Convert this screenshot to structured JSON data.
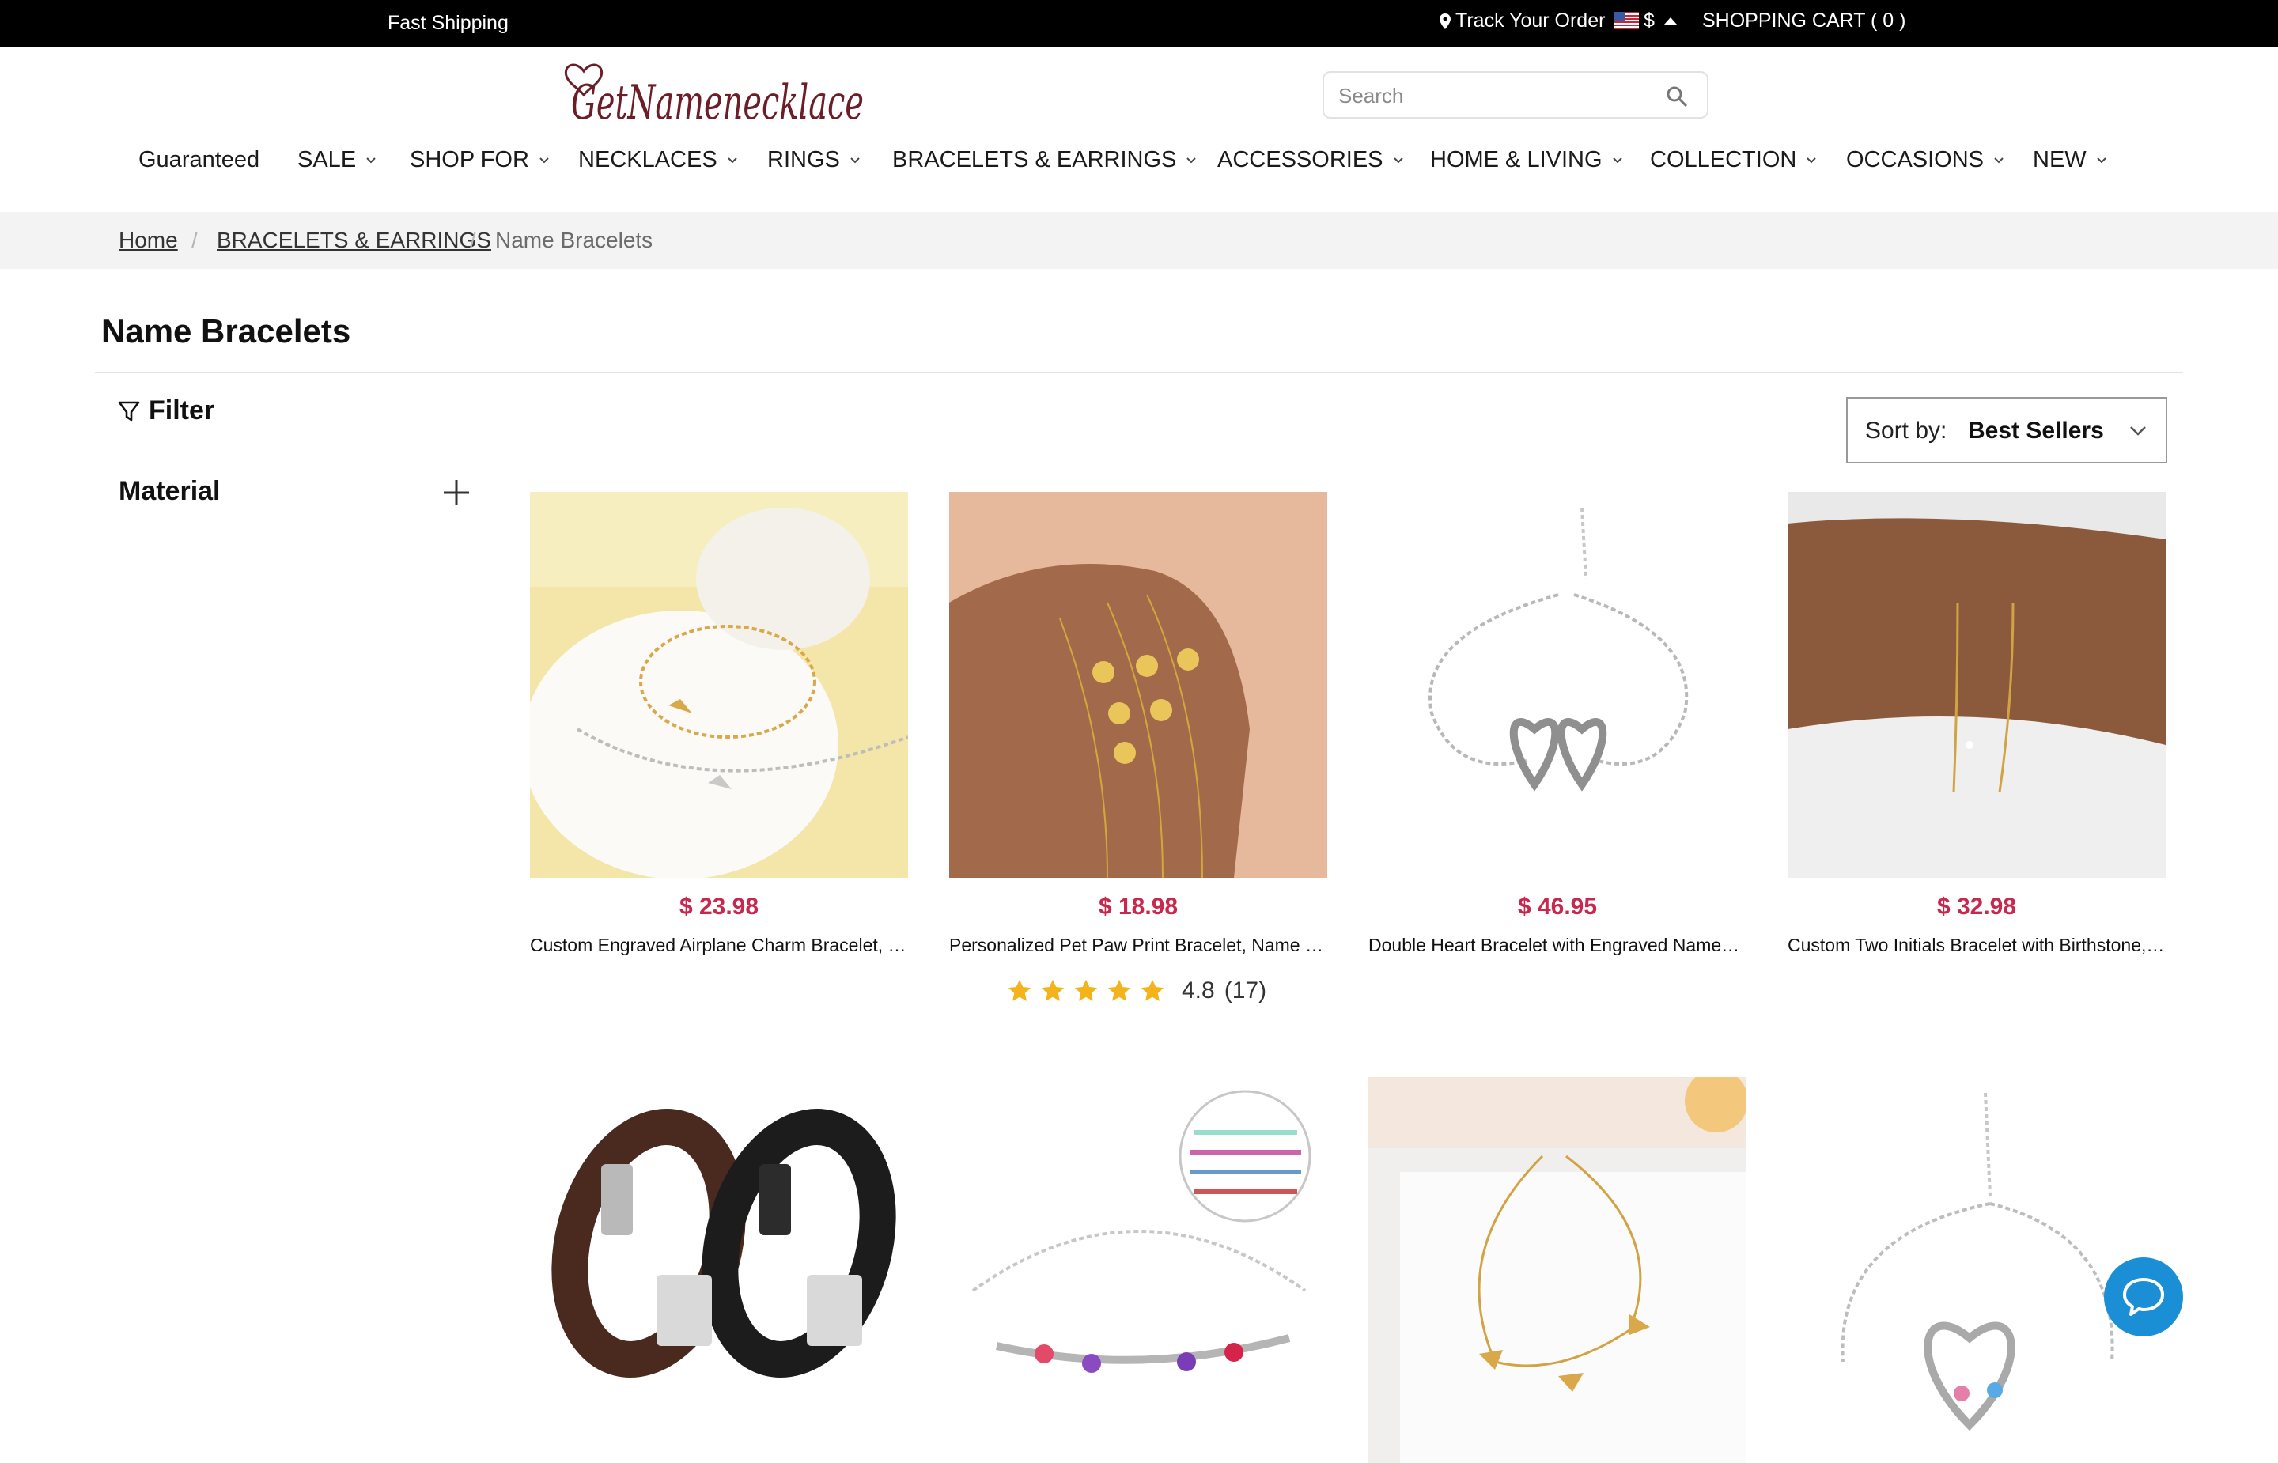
{
  "topbar": {
    "shipping": "Fast Shipping",
    "track": "Track Your Order",
    "currency": "$",
    "cart": "SHOPPING CART ( 0 )"
  },
  "header": {
    "logo_text": "GetNamenecklace",
    "search_placeholder": "Search"
  },
  "nav": [
    {
      "label": "Guaranteed",
      "dropdown": false
    },
    {
      "label": "SALE",
      "dropdown": true
    },
    {
      "label": "SHOP FOR",
      "dropdown": true
    },
    {
      "label": "NECKLACES",
      "dropdown": true
    },
    {
      "label": "RINGS",
      "dropdown": true
    },
    {
      "label": "BRACELETS & EARRINGS",
      "dropdown": true
    },
    {
      "label": "ACCESSORIES",
      "dropdown": true
    },
    {
      "label": "HOME & LIVING",
      "dropdown": true
    },
    {
      "label": "COLLECTION",
      "dropdown": true
    },
    {
      "label": "OCCASIONS",
      "dropdown": true
    },
    {
      "label": "NEW",
      "dropdown": true
    }
  ],
  "breadcrumb": {
    "home": "Home",
    "category": "BRACELETS & EARRINGS",
    "current": "Name Bracelets",
    "separator": "/"
  },
  "page": {
    "title": "Name Bracelets",
    "filter_label": "Filter",
    "material_label": "Material",
    "sort_label": "Sort by:",
    "sort_value": "Best Sellers"
  },
  "products": [
    {
      "price": "$ 23.98",
      "name": "Custom Engraved Airplane Charm Bracelet, St..."
    },
    {
      "price": "$ 18.98",
      "name": "Personalized Pet Paw Print Bracelet, Name En..."
    },
    {
      "price": "$ 46.95",
      "name": "Double Heart Bracelet with Engraved Names &..."
    },
    {
      "price": "$ 32.98",
      "name": "Custom Two Initials Bracelet with Birthstone, I..."
    }
  ],
  "rating": {
    "score": "4.8",
    "count": "(17)",
    "stars": 5
  },
  "colors": {
    "price": "#c8274e",
    "star": "#f5b31b",
    "chat": "#1a8fd6",
    "topbar": "#000000"
  }
}
